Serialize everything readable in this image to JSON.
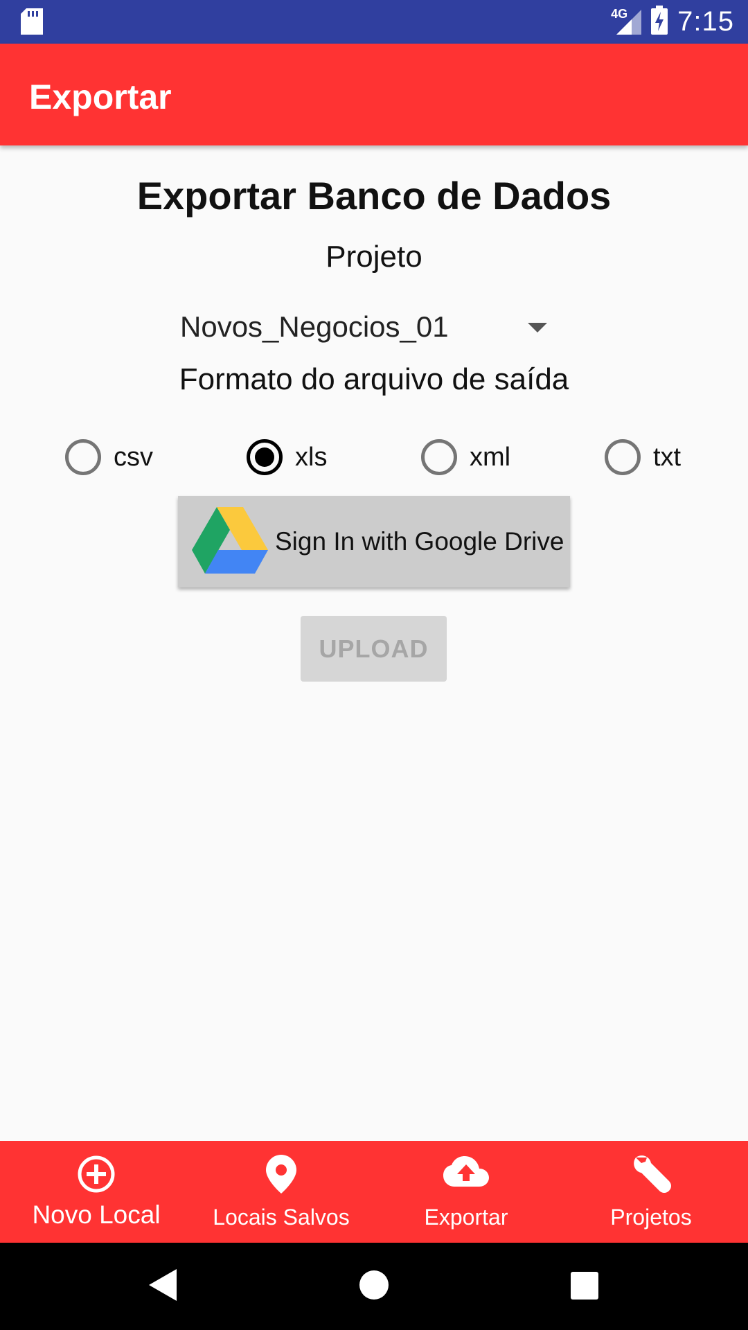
{
  "status_bar": {
    "time": "7:15",
    "network": "4G"
  },
  "app_bar": {
    "title": "Exportar"
  },
  "main": {
    "heading": "Exportar Banco de Dados",
    "project_label": "Projeto",
    "project_selected": "Novos_Negocios_01",
    "format_label": "Formato do arquivo de saída",
    "formats": [
      {
        "label": "csv",
        "checked": false
      },
      {
        "label": "xls",
        "checked": true
      },
      {
        "label": "xml",
        "checked": false
      },
      {
        "label": "txt",
        "checked": false
      }
    ],
    "google_drive_button": "Sign In with Google Drive",
    "upload_button": "UPLOAD"
  },
  "bottom_nav": {
    "items": [
      {
        "label": "Novo Local",
        "icon": "add-circle-icon",
        "active": true
      },
      {
        "label": "Locais Salvos",
        "icon": "location-pin-icon",
        "active": false
      },
      {
        "label": "Exportar",
        "icon": "cloud-upload-icon",
        "active": false
      },
      {
        "label": "Projetos",
        "icon": "wrench-icon",
        "active": false
      }
    ]
  },
  "colors": {
    "status_bar": "#303f9f",
    "accent": "#ff3333",
    "background": "#fafafa"
  }
}
